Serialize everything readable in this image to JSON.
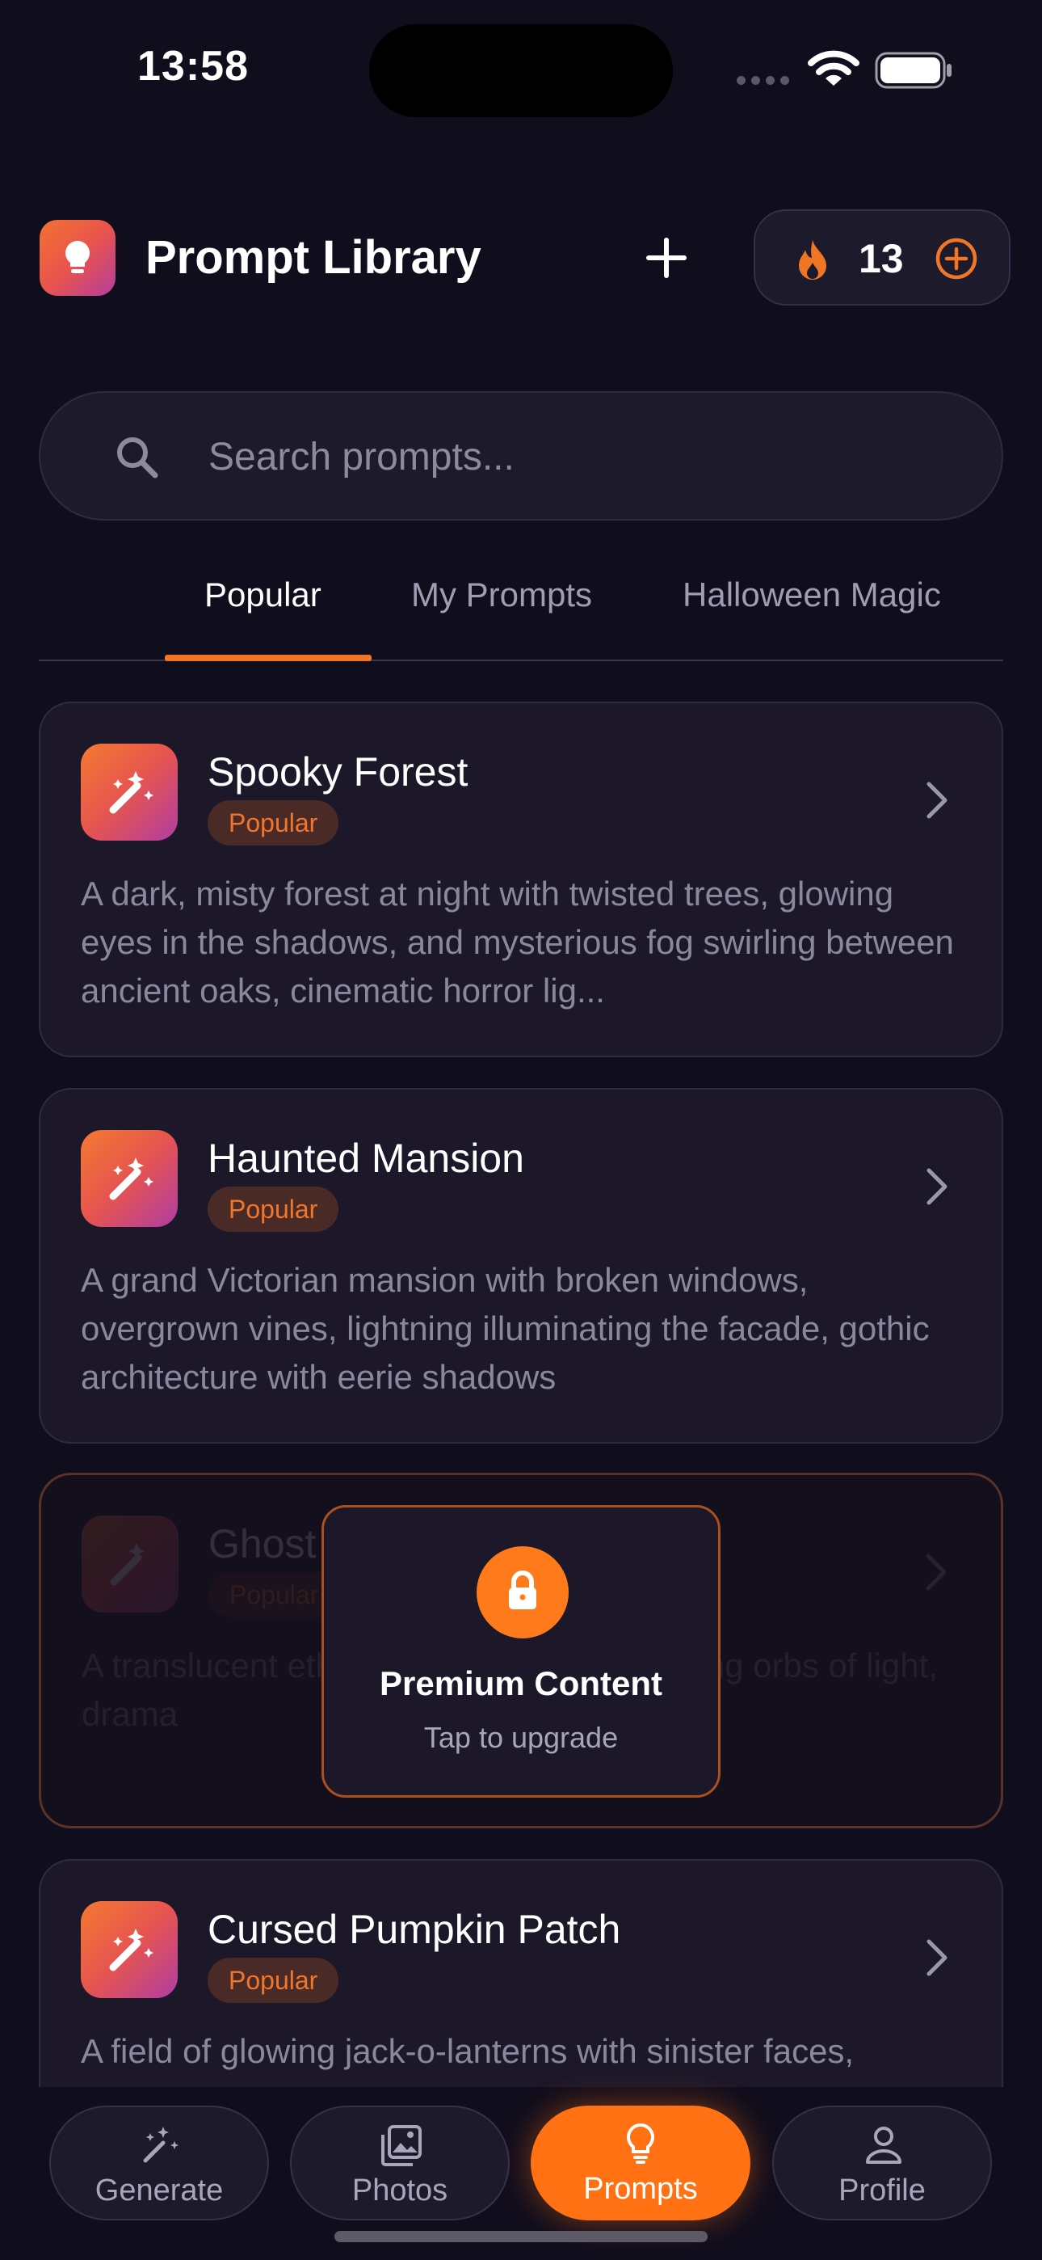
{
  "status_bar": {
    "time": "13:58"
  },
  "header": {
    "title": "Prompt Library",
    "credits": "13",
    "accent_color": "#f07626"
  },
  "search": {
    "placeholder": "Search prompts..."
  },
  "tabs": [
    {
      "label": "Popular",
      "active": true
    },
    {
      "label": "My Prompts",
      "active": false
    },
    {
      "label": "Halloween Magic",
      "active": false
    }
  ],
  "prompts": [
    {
      "title": "Spooky Forest",
      "badge": "Popular",
      "description": "A dark, misty forest at night with twisted trees, glowing eyes in the shadows, and mysterious fog swirling between ancient oaks, cinematic horror lig..."
    },
    {
      "title": "Haunted Mansion",
      "badge": "Popular",
      "description": "A grand Victorian mansion with broken windows, overgrown vines, lightning illuminating the facade, gothic architecture with eerie shadows"
    },
    {
      "title": "Ghost Portrait",
      "badge": "Popular",
      "description": "A translucent ethereal clothing, glow floating orbs of light, drama",
      "locked": true
    },
    {
      "title": "Cursed Pumpkin Patch",
      "badge": "Popular",
      "description": "A field of glowing jack-o-lanterns with sinister faces,"
    }
  ],
  "premium_overlay": {
    "title": "Premium Content",
    "subtitle": "Tap to upgrade"
  },
  "bottom_nav": [
    {
      "label": "Generate",
      "icon": "magic-wand-icon"
    },
    {
      "label": "Photos",
      "icon": "photos-icon"
    },
    {
      "label": "Prompts",
      "icon": "lightbulb-icon",
      "active": true
    },
    {
      "label": "Profile",
      "icon": "person-icon"
    }
  ]
}
